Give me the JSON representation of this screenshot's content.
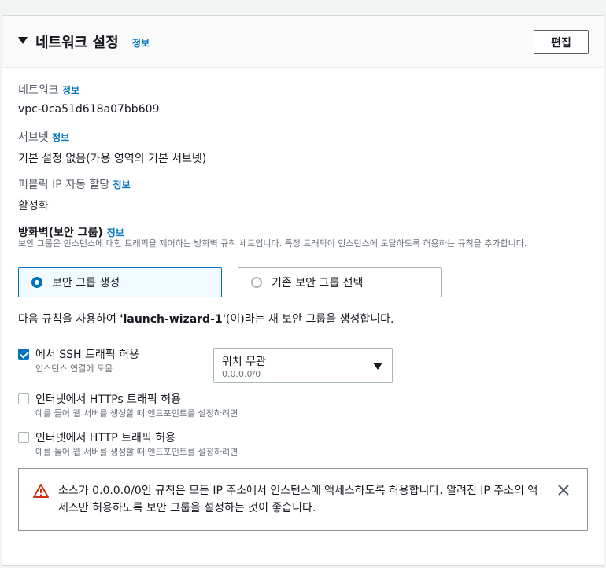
{
  "header": {
    "title": "네트워크 설정",
    "info": "정보",
    "edit_label": "편집"
  },
  "network": {
    "label": "네트워크",
    "info": "정보",
    "value": "vpc-0ca51d618a07bb609"
  },
  "subnet": {
    "label": "서브넷",
    "info": "정보",
    "value": "기본 설정 없음(가용 영역의 기본 서브넷)"
  },
  "public_ip": {
    "label": "퍼블릭 IP 자동 할당",
    "info": "정보",
    "value": "활성화"
  },
  "firewall": {
    "label": "방화벽(보안 그룹)",
    "info": "정보",
    "description": "보안 그룹은 인스턴스에 대한 트래픽을 제어하는 방화벽 규칙 세트입니다. 특정 트래픽이 인스턴스에 도달하도록 허용하는 규칙을 추가합니다.",
    "options": [
      {
        "label": "보안 그룹 생성",
        "selected": true
      },
      {
        "label": "기존 보안 그룹 선택",
        "selected": false
      }
    ],
    "sentence_prefix": "다음 규칙을 사용하여 ",
    "sentence_name": "'launch-wizard-1'",
    "sentence_suffix": "(이)라는 새 보안 그룹을 생성합니다."
  },
  "rules": [
    {
      "label": "에서 SSH 트래픽 허용",
      "sub": "인스턴스 연결에 도움",
      "checked": true
    },
    {
      "label": "인터넷에서 HTTPs 트래픽 허용",
      "sub": "예를 들어 웹 서버를 생성할 때 엔드포인트를 설정하려면",
      "checked": false
    },
    {
      "label": "인터넷에서 HTTP 트래픽 허용",
      "sub": "예를 들어 웹 서버를 생성할 때 엔드포인트를 설정하려면",
      "checked": false
    }
  ],
  "source_select": {
    "value": "위치 무관",
    "sub": "0.0.0.0/0"
  },
  "alert": {
    "text": "소스가 0.0.0.0/0인 규칙은 모든 IP 주소에서 인스턴스에 액세스하도록 허용합니다. 알려진 IP 주소의 액세스만 허용하도록 보안 그룹을 설정하는 것이 좋습니다."
  },
  "colors": {
    "link": "#0073bb",
    "warning": "#d13212",
    "selected_tile_bg": "#f1faff"
  }
}
